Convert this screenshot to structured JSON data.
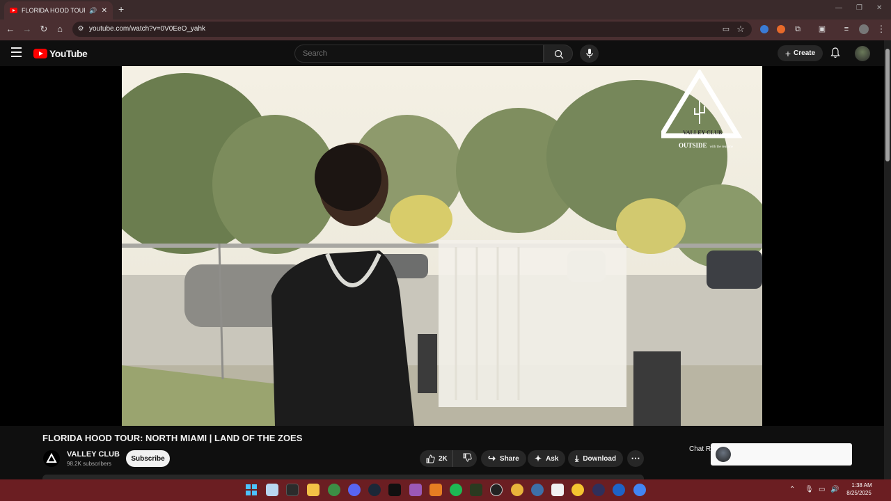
{
  "browser": {
    "tab_title": "FLORIDA HOOD TOUR: NO",
    "url": "youtube.com/watch?v=0V0EeO_yahk"
  },
  "youtube": {
    "logo_text": "YouTube",
    "search_placeholder": "Search",
    "create_label": "Create"
  },
  "video": {
    "overlay_brand": "VALLEY CLUB",
    "overlay_tagline": "OUTSIDE",
    "overlay_tagline_small": "with the real one"
  },
  "meta": {
    "title": "FLORIDA HOOD TOUR: NORTH MIAMI | LAND OF THE ZOES",
    "channel": "VALLEY CLUB",
    "subscribers": "98.2K subscribers",
    "subscribe_label": "Subscribe",
    "likes": "2K",
    "share_label": "Share",
    "ask_label": "Ask",
    "download_label": "Download",
    "chat_label": "Chat Re"
  },
  "taskbar": {
    "time": "1:38 AM",
    "date": "8/25/2025"
  },
  "colors": {
    "youtube_red": "#ff0000",
    "taskbar": "#6b1e22",
    "browser_frame": "#4a2f31"
  }
}
